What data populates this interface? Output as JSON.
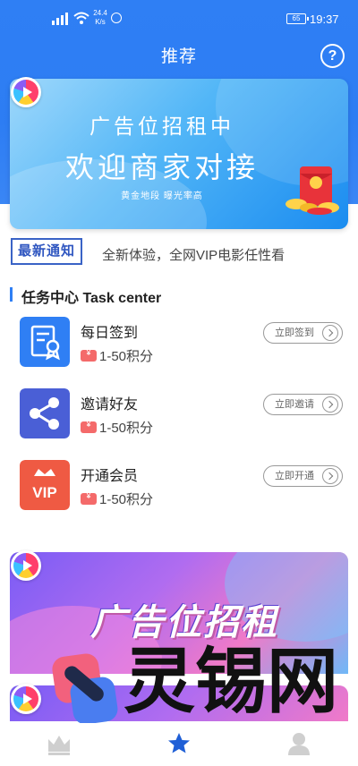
{
  "status_bar": {
    "speed_value": "24.4",
    "speed_unit": "K/s",
    "battery": "65",
    "time": "19:37"
  },
  "header": {
    "title": "推荐",
    "help_label": "?"
  },
  "banner": {
    "line1": "广告位招租中",
    "line2": "欢迎商家对接",
    "line3": "黄金地段  曝光率高"
  },
  "notice": {
    "tag": "最新通知",
    "text": "全新体验，全网VIP电影任性看"
  },
  "task_center": {
    "title": "任务中心 Task center",
    "tasks": [
      {
        "name": "每日签到",
        "reward": "1-50积分",
        "button": "立即签到",
        "icon": "certificate-icon",
        "color": "#2f7ff4"
      },
      {
        "name": "邀请好友",
        "reward": "1-50积分",
        "button": "立即邀请",
        "icon": "share-icon",
        "color": "#4a5fd6"
      },
      {
        "name": "开通会员",
        "reward": "1-50积分",
        "button": "立即开通",
        "icon": "vip-crown-icon",
        "color": "#ef5a43"
      }
    ]
  },
  "banner2": {
    "text": "广告位招租"
  },
  "watermark": {
    "text": "灵锡网"
  },
  "bottom_nav": {
    "items": [
      {
        "icon": "crown-icon",
        "active": false
      },
      {
        "icon": "star-icon",
        "active": true
      },
      {
        "icon": "user-icon",
        "active": false
      }
    ]
  },
  "colors": {
    "primary": "#2f7ff4",
    "notice_tag": "#2f56c0",
    "vip": "#ef5a43"
  }
}
